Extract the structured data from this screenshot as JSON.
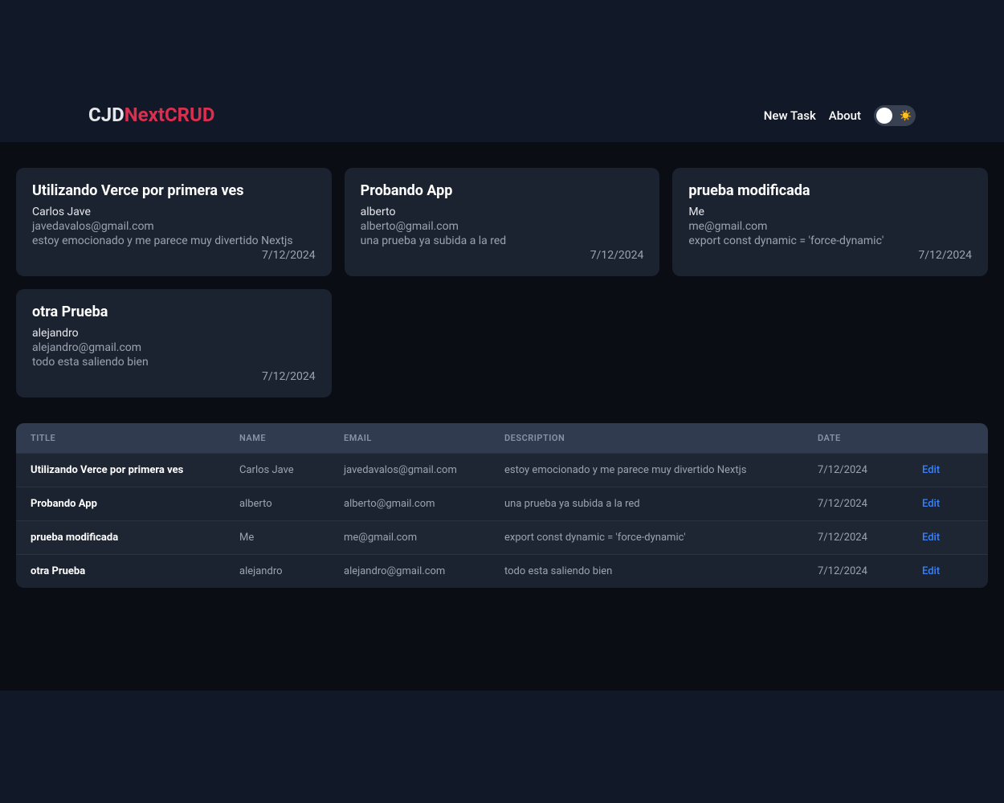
{
  "header": {
    "logo_prefix": "CJD",
    "logo_suffix": "NextCRUD",
    "nav": {
      "new_task": "New Task",
      "about": "About"
    }
  },
  "cards": [
    {
      "title": "Utilizando Verce por primera ves",
      "name": "Carlos Jave",
      "email": "javedavalos@gmail.com",
      "description": "estoy emocionado y me parece muy divertido Nextjs",
      "date": "7/12/2024"
    },
    {
      "title": "Probando App",
      "name": "alberto",
      "email": "alberto@gmail.com",
      "description": "una prueba ya subida a la red",
      "date": "7/12/2024"
    },
    {
      "title": "prueba modificada",
      "name": "Me",
      "email": "me@gmail.com",
      "description": "export const dynamic = 'force-dynamic'",
      "date": "7/12/2024"
    },
    {
      "title": "otra Prueba",
      "name": "alejandro",
      "email": "alejandro@gmail.com",
      "description": "todo esta saliendo bien",
      "date": "7/12/2024"
    }
  ],
  "table": {
    "headers": {
      "title": "TITLE",
      "name": "NAME",
      "email": "EMAIL",
      "description": "DESCRIPTION",
      "date": "DATE"
    },
    "edit_label": "Edit",
    "rows": [
      {
        "title": "Utilizando Verce por primera ves",
        "name": "Carlos Jave",
        "email": "javedavalos@gmail.com",
        "description": "estoy emocionado y me parece muy divertido Nextjs",
        "date": "7/12/2024"
      },
      {
        "title": "Probando App",
        "name": "alberto",
        "email": "alberto@gmail.com",
        "description": "una prueba ya subida a la red",
        "date": "7/12/2024"
      },
      {
        "title": "prueba modificada",
        "name": "Me",
        "email": "me@gmail.com",
        "description": "export const dynamic = 'force-dynamic'",
        "date": "7/12/2024"
      },
      {
        "title": "otra Prueba",
        "name": "alejandro",
        "email": "alejandro@gmail.com",
        "description": "todo esta saliendo bien",
        "date": "7/12/2024"
      }
    ]
  }
}
